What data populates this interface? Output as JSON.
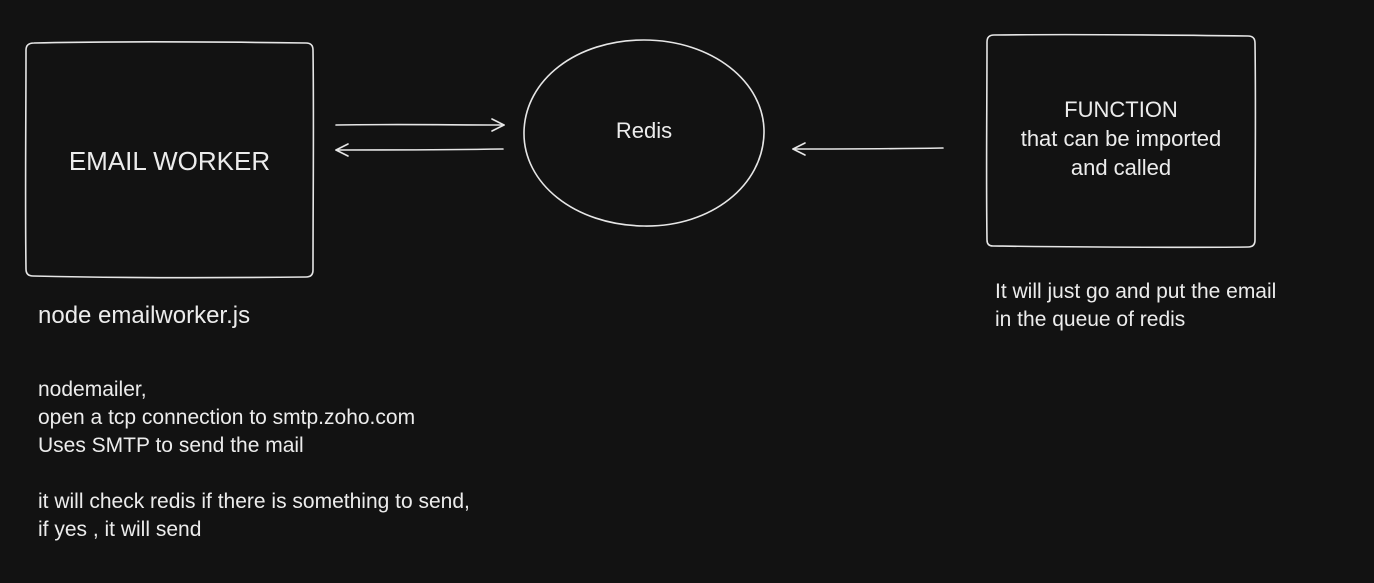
{
  "colors": {
    "background": "#121212",
    "stroke": "#e6e6e6",
    "text": "#ececec"
  },
  "nodes": {
    "email_worker": {
      "label": "EMAIL WORKER"
    },
    "redis": {
      "label": "Redis"
    },
    "function": {
      "lines": [
        "FUNCTION",
        "that can be imported",
        "and called"
      ]
    }
  },
  "notes": {
    "worker_command": "node emailworker.js",
    "worker_details": [
      "nodemailer,",
      "open a tcp connection to smtp.zoho.com",
      "Uses SMTP to send the mail"
    ],
    "worker_behavior": [
      "it will check redis if there is something to send,",
      "if yes , it will send"
    ],
    "function_details": [
      "It will just go and put the email",
      "in the queue of redis"
    ]
  }
}
